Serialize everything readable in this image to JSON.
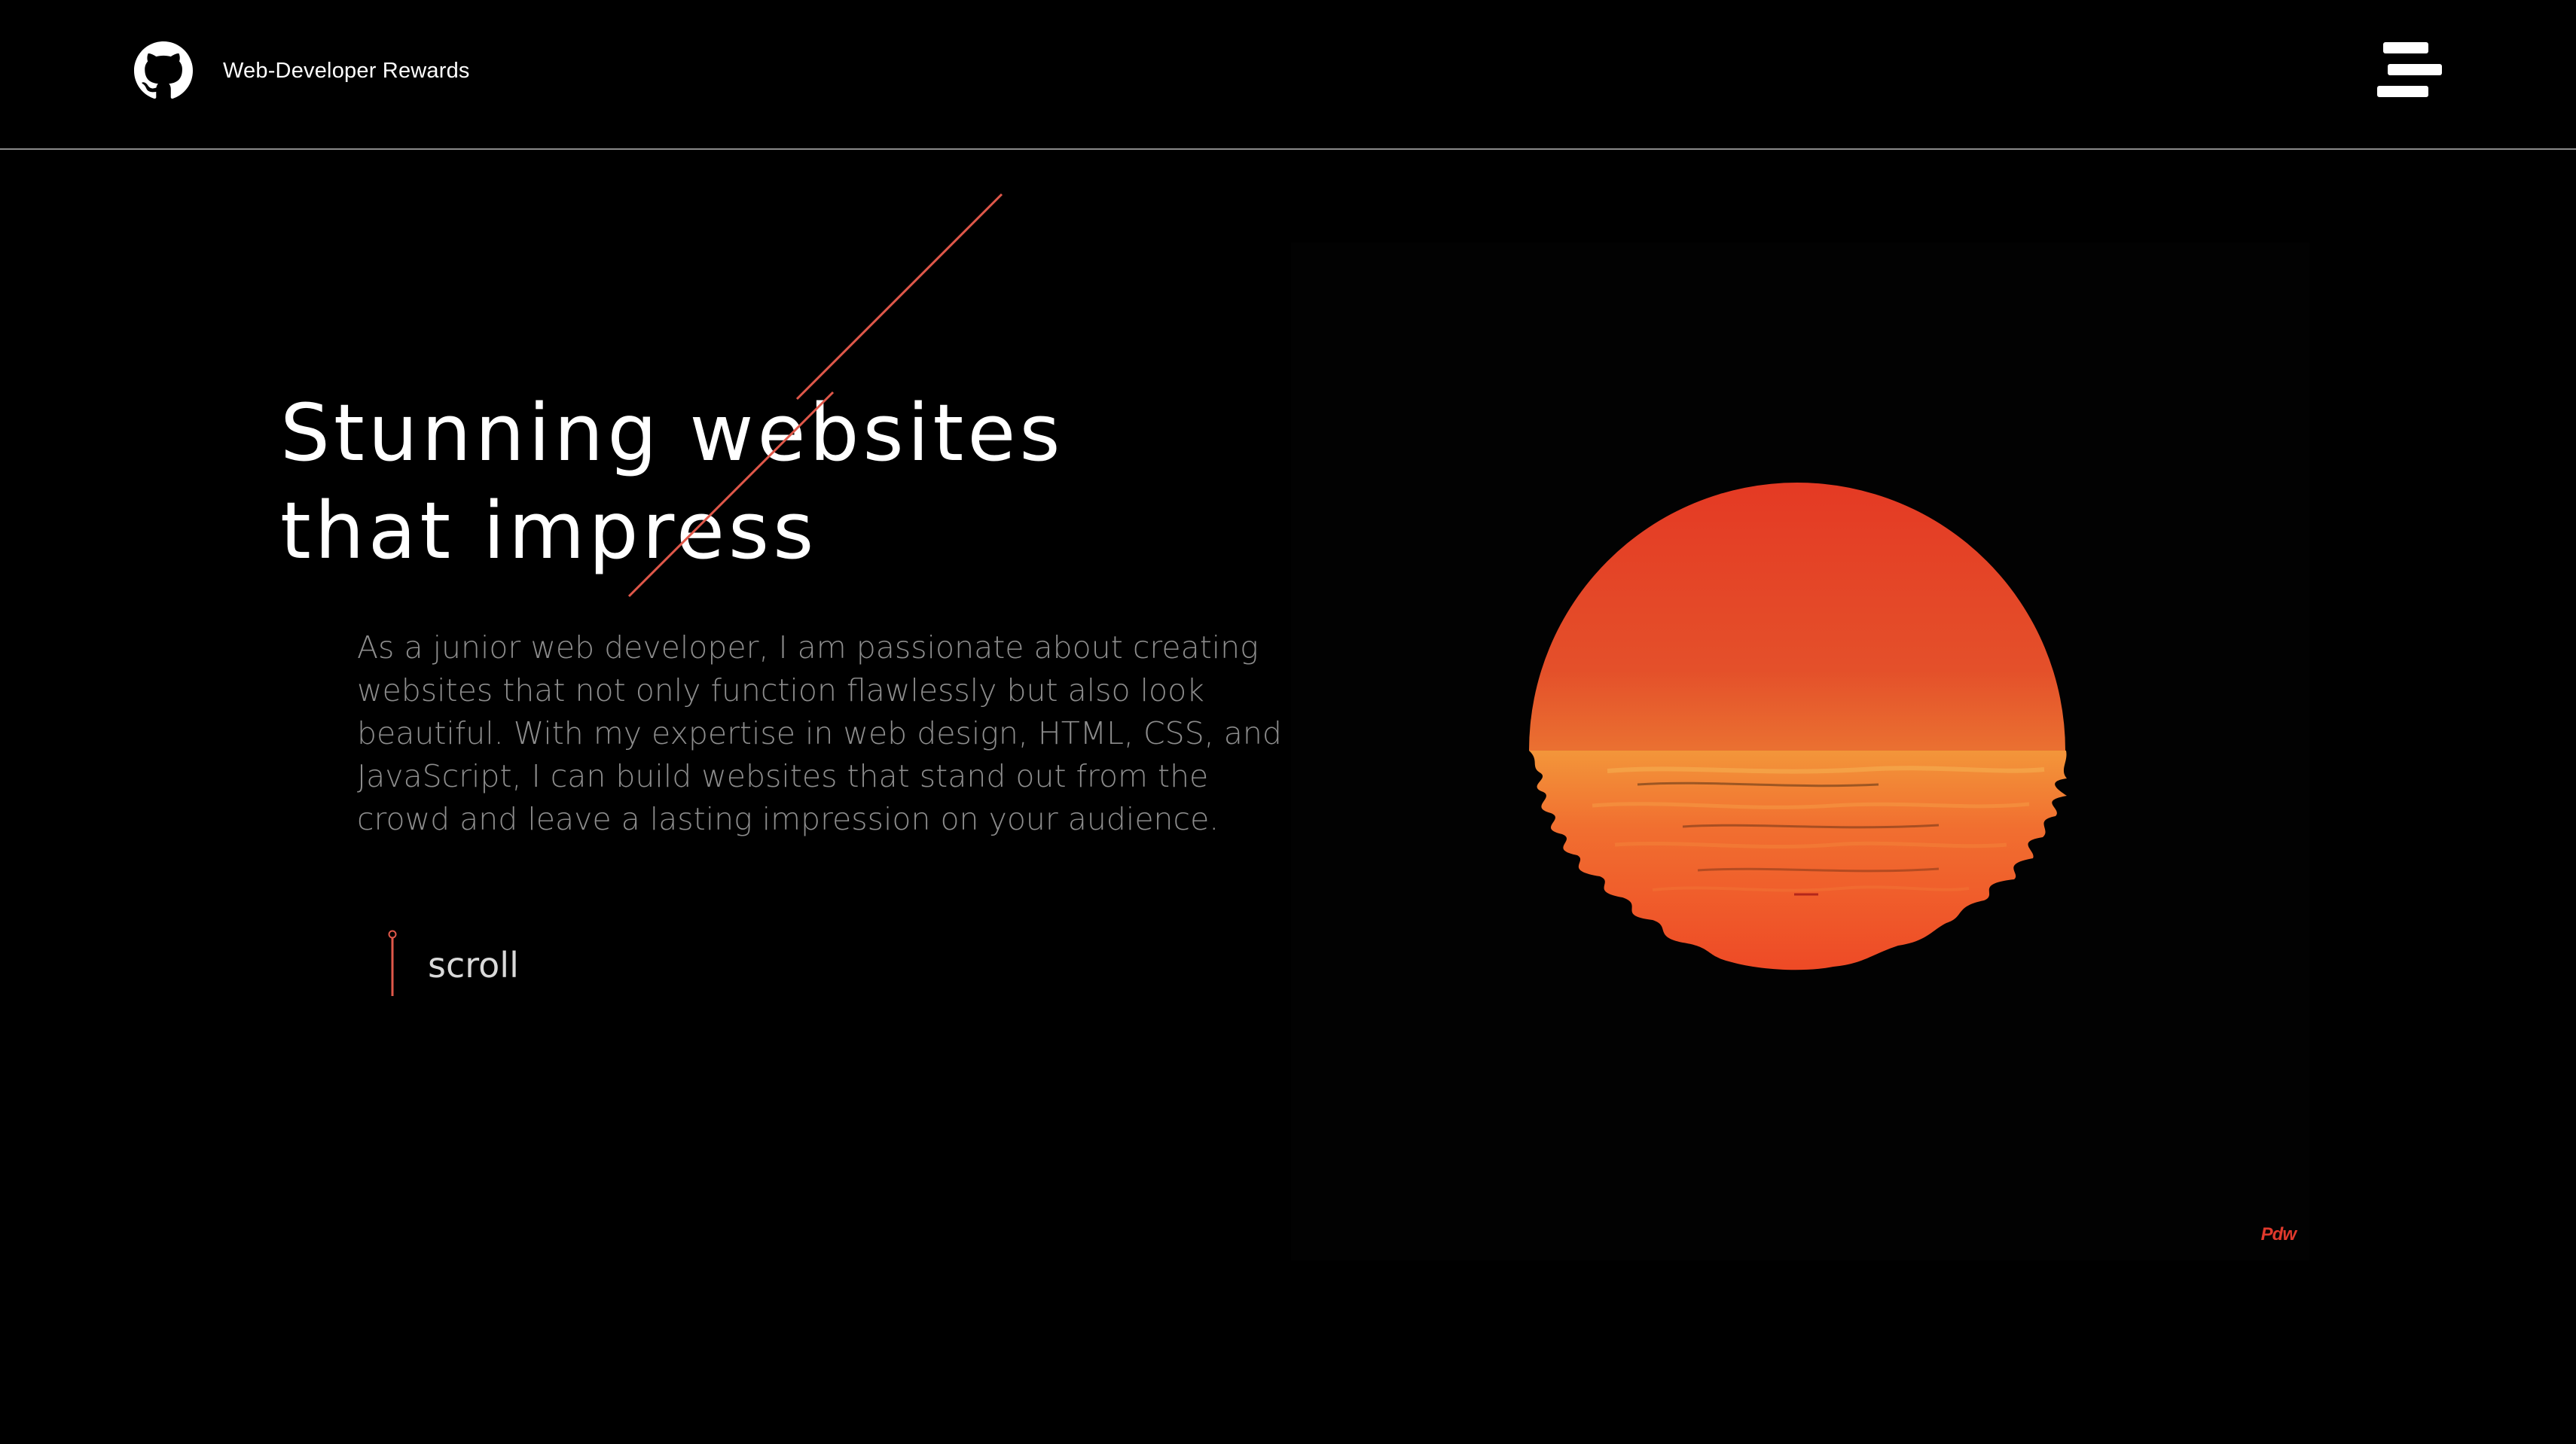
{
  "header": {
    "logo_icon": "github-icon",
    "site_title": "Web-Developer Rewards",
    "menu_icon": "hamburger-menu-icon"
  },
  "hero": {
    "title_line_1": "Stunning websites",
    "title_line_2": "that impress",
    "description": "As a junior web developer, I am passionate about creating websites that not only function flawlessly but also look beautiful. With my expertise in web design, HTML, CSS, and JavaScript, I can build websites that stand out from the crowd and leave a lasting impression on your audience.",
    "scroll_label": "scroll"
  },
  "artwork": {
    "signature": "Pdw",
    "sun_top_color": "#e34326",
    "sun_mid_color": "#f1993a",
    "reflection_color": "#f15a2c"
  },
  "colors": {
    "background": "#000000",
    "accent": "#e0584a",
    "text_primary": "#ffffff",
    "text_muted": "#8d8d8d",
    "divider": "#8a8a8a"
  }
}
